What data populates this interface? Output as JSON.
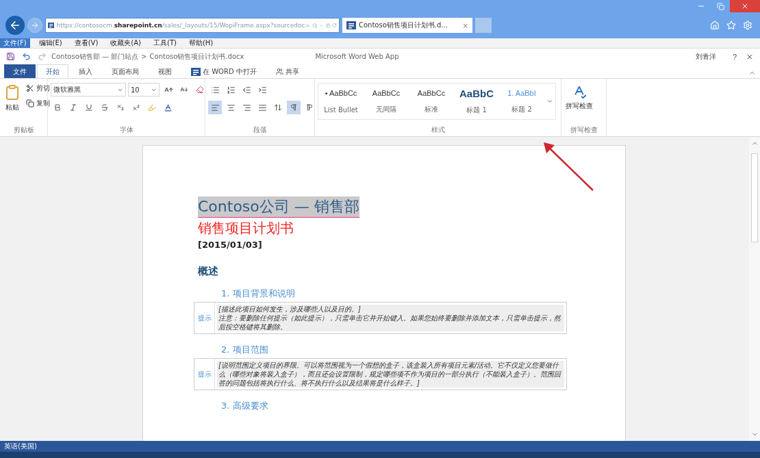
{
  "browser": {
    "url": "https://contosocm.**sharepoint.cn**/sales/_layouts/15/WopiFrame.aspx?sourcedoc=",
    "tab_title": "Contoso销售项目计划书.d...",
    "tab_close": "×"
  },
  "menu": [
    {
      "label": "文件(F)",
      "selected": true
    },
    {
      "label": "编辑(E)",
      "selected": false
    },
    {
      "label": "查看(V)",
      "selected": false
    },
    {
      "label": "收藏夹(A)",
      "selected": false
    },
    {
      "label": "工具(T)",
      "selected": false
    },
    {
      "label": "帮助(H)",
      "selected": false
    }
  ],
  "app": {
    "breadcrumb": [
      "Contoso销售部 — 部门站点",
      "Contoso销售项目计划书.docx"
    ],
    "separator": ">",
    "title": "Microsoft Word Web App",
    "user": "刘青洋",
    "help": "?"
  },
  "ribbon_tabs": [
    {
      "label": "文件",
      "kind": "file",
      "selected": false
    },
    {
      "label": "开始",
      "kind": "tab",
      "selected": true
    },
    {
      "label": "插入",
      "kind": "tab",
      "selected": false
    },
    {
      "label": "页面布局",
      "kind": "tab",
      "selected": false
    },
    {
      "label": "视图",
      "kind": "tab",
      "selected": false
    },
    {
      "label": "在 WORD 中打开",
      "kind": "open",
      "selected": false
    },
    {
      "label": "共享",
      "kind": "share",
      "selected": false
    }
  ],
  "clipboard": {
    "paste": "粘贴",
    "cut": "剪切",
    "copy": "复制",
    "group": "剪贴板"
  },
  "font": {
    "name": "微软雅黑",
    "size": "10",
    "group": "字体"
  },
  "paragraph": {
    "align": [
      {
        "kind": "left",
        "selected": true
      },
      {
        "kind": "center",
        "selected": false
      },
      {
        "kind": "right",
        "selected": false
      },
      {
        "kind": "justify",
        "selected": false
      }
    ],
    "direction": [
      {
        "kind": "ltr",
        "selected": true
      },
      {
        "kind": "rtl",
        "selected": false
      }
    ],
    "group": "段落"
  },
  "styles": {
    "items": [
      {
        "sample": "• AaBbCc",
        "name": "List Bullet",
        "kind": "bullet"
      },
      {
        "sample": "AaBbCc",
        "name": "无间隔",
        "kind": "plain"
      },
      {
        "sample": "AaBbCc",
        "name": "标准",
        "kind": "normal"
      },
      {
        "sample": "AaBbC",
        "name": "标题 1",
        "kind": "h1"
      },
      {
        "sample": "1. AaBbI",
        "name": "标题 2",
        "kind": "h2"
      }
    ],
    "group": "样式"
  },
  "proofing": {
    "button": "拼写检查",
    "group": "拼写检查"
  },
  "document": {
    "title": "Contoso公司 — 销售部",
    "subtitle": "销售项目计划书",
    "date": "[2015/01/03]",
    "heading": "概述",
    "sections": [
      {
        "number": "1.",
        "title": "项目背景和说明",
        "tip_label": "提示",
        "tip": "[描述此项目如何发生，涉及哪些人以及目的。]\n注意：要删除任何提示（如此提示），只需单击它并开始键入。如果您始终要删除并添加文本，只需单击提示，然后按空格键将其删除。"
      },
      {
        "number": "2.",
        "title": "项目范围",
        "tip_label": "提示",
        "tip": "[说明范围定义项目的界限。可以将范围视为一个假想的盒子，该盒装入所有项目元素/活动。它不仅定义您要做什么（哪些对象将装入盒子），而且还会设置限制，规定哪些项不作为项目的一部分执行（不能装入盒子）。范围回答的问题包括将执行什么、将不执行什么以及结果将是什么样子。]"
      },
      {
        "number": "3.",
        "title": "高级要求"
      }
    ]
  },
  "status_bar": {
    "language": "英语(美国)"
  }
}
